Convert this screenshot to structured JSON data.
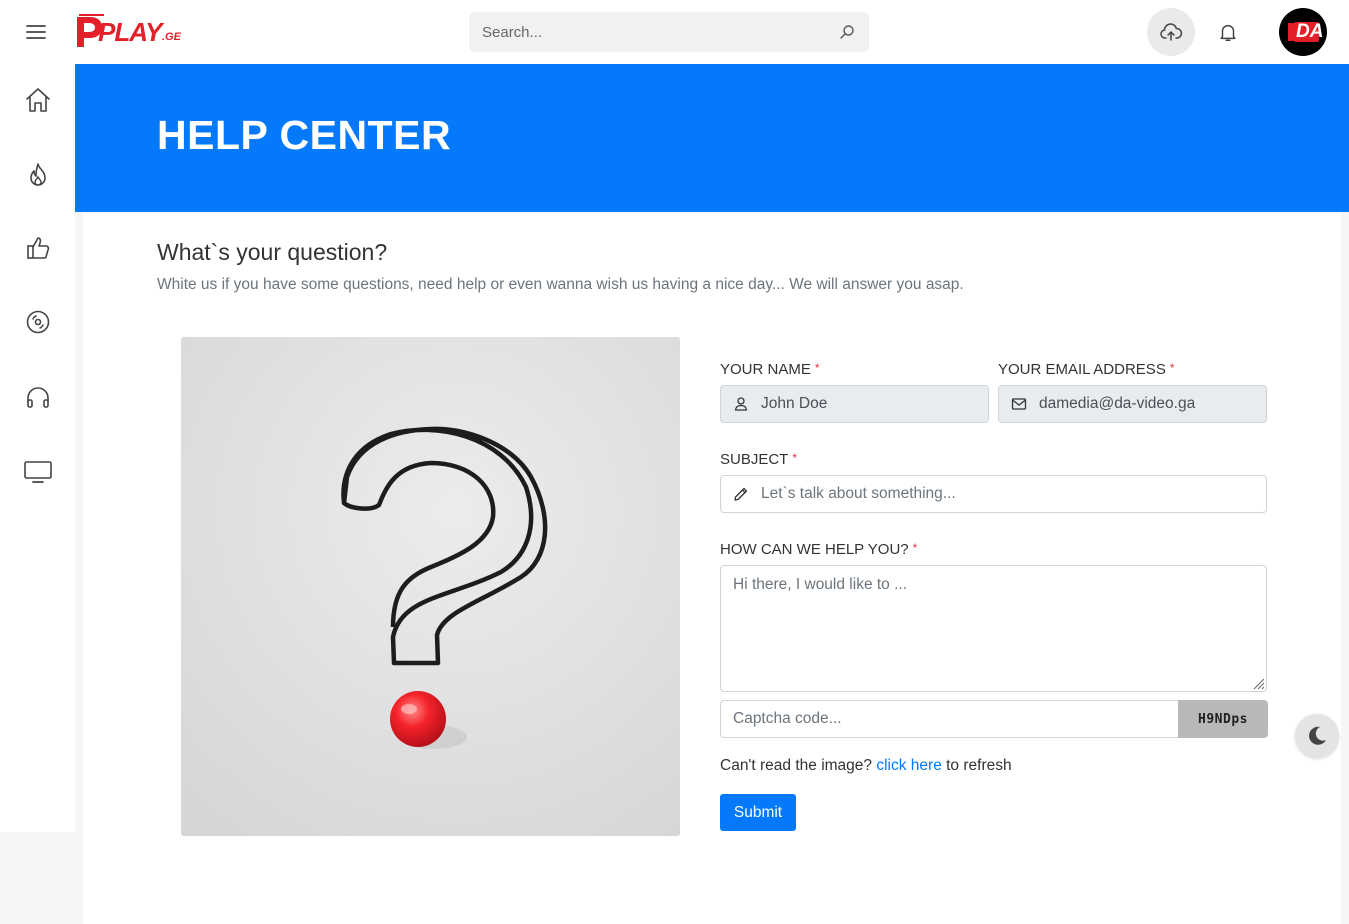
{
  "header": {
    "logo_text": "PLAY",
    "logo_suffix": ".GE",
    "search_placeholder": "Search...",
    "avatar_text": "DA"
  },
  "sidebar": {
    "items": [
      {
        "icon": "home-icon"
      },
      {
        "icon": "fire-icon"
      },
      {
        "icon": "thumbs-up-icon"
      },
      {
        "icon": "disc-icon"
      },
      {
        "icon": "headphones-icon"
      },
      {
        "icon": "tv-icon"
      }
    ]
  },
  "hero": {
    "title": "HELP CENTER"
  },
  "main": {
    "question_title": "What`s your question?",
    "question_subtitle": "White us if you have some questions, need help or even wanna wish us having a nice day... We will answer you asap."
  },
  "form": {
    "name_label": "YOUR NAME",
    "name_value": "John Doe",
    "email_label": "YOUR EMAIL ADDRESS",
    "email_value": "damedia@da-video.ga",
    "subject_label": "SUBJECT",
    "subject_placeholder": "Let`s talk about something...",
    "message_label": "HOW CAN WE HELP YOU?",
    "message_placeholder": "Hi there, I would like to ...",
    "captcha_placeholder": "Captcha code...",
    "captcha_code": "H9NDps",
    "refresh_prefix": "Can't read the image? ",
    "refresh_link": "click here",
    "refresh_suffix": " to refresh",
    "submit_label": "Submit",
    "required_mark": "*"
  },
  "colors": {
    "accent": "#0479fa",
    "required": "#dc3545",
    "logo_red": "#e3202a"
  }
}
